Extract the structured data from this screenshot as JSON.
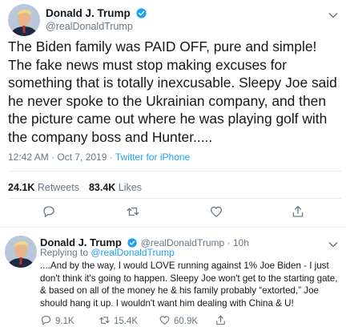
{
  "main_tweet": {
    "display_name": "Donald J. Trump",
    "handle": "@realDonaldTrump",
    "text": "The Biden family was PAID OFF, pure and simple! The fake news must stop making excuses for something that is totally inexcusable. Sleepy Joe said he never spoke to the Ukrainian company, and then the picture came out where he was playing golf with the company boss and Hunter.....",
    "timestamp": "12:42 AM · Oct 7, 2019 · ",
    "source": "Twitter for iPhone",
    "retweets_count": "24.1K",
    "retweets_label": "Retweets",
    "likes_count": "83.4K",
    "likes_label": "Likes",
    "icons": [
      "reply-icon",
      "retweet-icon",
      "like-icon",
      "share-icon",
      "caret-down-icon",
      "verified-badge-icon"
    ]
  },
  "reply_tweet": {
    "display_name": "Donald J. Trump",
    "handle_time": "@realDonaldTrump · 10h",
    "replying_prefix": "Replying to ",
    "replying_to": "@realDonaldTrump",
    "text": "....And by the way, I would LOVE running against 1% Joe Biden - I just don't think it's going to happen. Sleepy Joe won't get to the starting gate, & based on all of the money he & his family probably “extorted,” Joe should hang it up. I wouldn't want him dealing with China & U!",
    "reply_count": "9.1K",
    "retweet_count": "15.4K",
    "like_count": "60.9K"
  },
  "colors": {
    "accent": "#1da1f2",
    "secondary_text": "#657786",
    "primary_text": "#14171a",
    "divider": "#e6ecf0"
  }
}
